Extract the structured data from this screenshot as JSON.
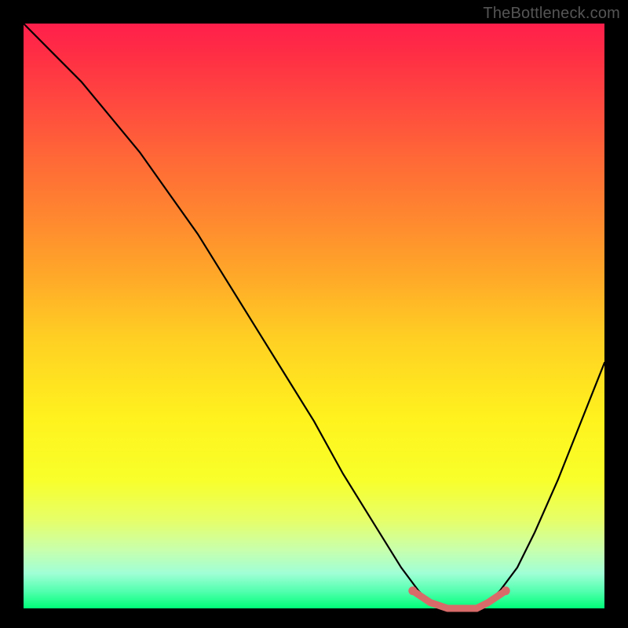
{
  "watermark": "TheBottleneck.com",
  "chart_data": {
    "type": "line",
    "title": "",
    "xlabel": "",
    "ylabel": "",
    "xlim": [
      0,
      100
    ],
    "ylim": [
      0,
      100
    ],
    "grid": false,
    "legend": false,
    "series": [
      {
        "name": "bottleneck-curve",
        "color": "#000000",
        "x": [
          0,
          5,
          10,
          15,
          20,
          25,
          30,
          35,
          40,
          45,
          50,
          55,
          60,
          65,
          68,
          70,
          73,
          76,
          78,
          80,
          82,
          85,
          88,
          92,
          96,
          100
        ],
        "values": [
          100,
          95,
          90,
          84,
          78,
          71,
          64,
          56,
          48,
          40,
          32,
          23,
          15,
          7,
          3,
          1,
          0,
          0,
          0,
          1,
          3,
          7,
          13,
          22,
          32,
          42
        ]
      },
      {
        "name": "optimal-range-highlight",
        "color": "#d86a6a",
        "x": [
          67,
          70,
          73,
          76,
          78,
          80,
          83
        ],
        "values": [
          3,
          1,
          0,
          0,
          0,
          1,
          3
        ]
      }
    ],
    "gradient_stops": [
      {
        "pos": 0,
        "color": "#ff1f4b"
      },
      {
        "pos": 34,
        "color": "#ff8a2f"
      },
      {
        "pos": 68,
        "color": "#fff31e"
      },
      {
        "pos": 100,
        "color": "#00ff78"
      }
    ]
  }
}
